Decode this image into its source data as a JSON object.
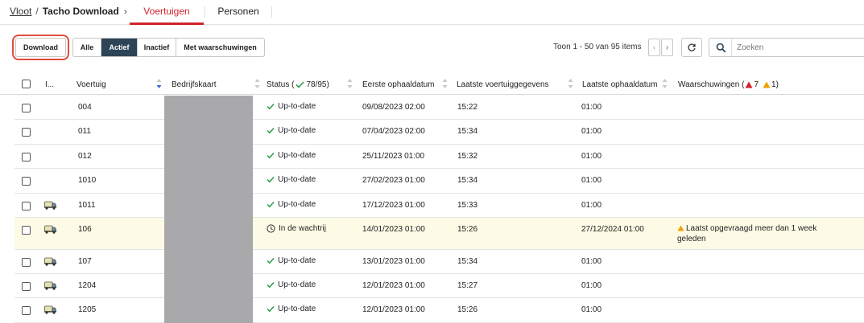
{
  "breadcrumb": {
    "root": "Vloot",
    "separator": "/",
    "current": "Tacho Download",
    "chevron": "›"
  },
  "tabs": [
    {
      "label": "Voertuigen",
      "active": true
    },
    {
      "label": "Personen",
      "active": false
    }
  ],
  "toolbar": {
    "download_label": "Download",
    "filters": [
      {
        "label": "Alle",
        "active": false
      },
      {
        "label": "Actief",
        "active": true
      },
      {
        "label": "Inactief",
        "active": false
      },
      {
        "label": "Met waarschuwingen",
        "active": false
      }
    ],
    "pager_text": "Toon 1 - 50 van 95 items",
    "prev_label": "‹",
    "next_label": "›",
    "refresh_icon": "refresh-icon",
    "search_placeholder": "Zoeken"
  },
  "table": {
    "headers": {
      "icon": "I...",
      "vehicle": "Voertuig",
      "card": "Bedrijfskaart",
      "status_prefix": "Status (",
      "status_count": "78/95",
      "status_suffix": ")",
      "first": "Eerste ophaaldatum",
      "last_vehicle": "Laatste voertuiggegevens",
      "last_fetch": "Laatste ophaaldatum",
      "warnings_prefix": "Waarschuwingen (",
      "warnings_red": "7",
      "warnings_orange": "1",
      "warnings_suffix": ")"
    },
    "rows": [
      {
        "vehicle": "004",
        "truck": false,
        "status": "Up-to-date",
        "status_kind": "ok",
        "first": "09/08/2023 02:00",
        "last_vehicle": "15:22",
        "last_fetch": "01:00",
        "warning": ""
      },
      {
        "vehicle": "011",
        "truck": false,
        "status": "Up-to-date",
        "status_kind": "ok",
        "first": "07/04/2023 02:00",
        "last_vehicle": "15:34",
        "last_fetch": "01:00",
        "warning": ""
      },
      {
        "vehicle": "012",
        "truck": false,
        "status": "Up-to-date",
        "status_kind": "ok",
        "first": "25/11/2023 01:00",
        "last_vehicle": "15:32",
        "last_fetch": "01:00",
        "warning": ""
      },
      {
        "vehicle": "1010",
        "truck": false,
        "status": "Up-to-date",
        "status_kind": "ok",
        "first": "27/02/2023 01:00",
        "last_vehicle": "15:34",
        "last_fetch": "01:00",
        "warning": ""
      },
      {
        "vehicle": "1011",
        "truck": true,
        "status": "Up-to-date",
        "status_kind": "ok",
        "first": "17/12/2023 01:00",
        "last_vehicle": "15:33",
        "last_fetch": "01:00",
        "warning": ""
      },
      {
        "vehicle": "106",
        "truck": true,
        "status": "In de wachtrij",
        "status_kind": "queue",
        "first": "14/01/2023 01:00",
        "last_vehicle": "15:26",
        "last_fetch": "27/12/2024 01:00",
        "warning": "Laatst opgevraagd meer dan 1 week geleden"
      },
      {
        "vehicle": "107",
        "truck": true,
        "status": "Up-to-date",
        "status_kind": "ok",
        "first": "13/01/2023 01:00",
        "last_vehicle": "15:34",
        "last_fetch": "01:00",
        "warning": ""
      },
      {
        "vehicle": "1204",
        "truck": true,
        "status": "Up-to-date",
        "status_kind": "ok",
        "first": "12/01/2023 01:00",
        "last_vehicle": "15:27",
        "last_fetch": "01:00",
        "warning": ""
      },
      {
        "vehicle": "1205",
        "truck": true,
        "status": "Up-to-date",
        "status_kind": "ok",
        "first": "12/01/2023 01:00",
        "last_vehicle": "15:26",
        "last_fetch": "01:00",
        "warning": ""
      }
    ]
  },
  "colors": {
    "accent_red": "#d2232a",
    "active_filter": "#2d4457",
    "ok_green": "#2e9a48",
    "warning_orange": "#f0a000",
    "row_highlight": "#fdfbe6"
  }
}
